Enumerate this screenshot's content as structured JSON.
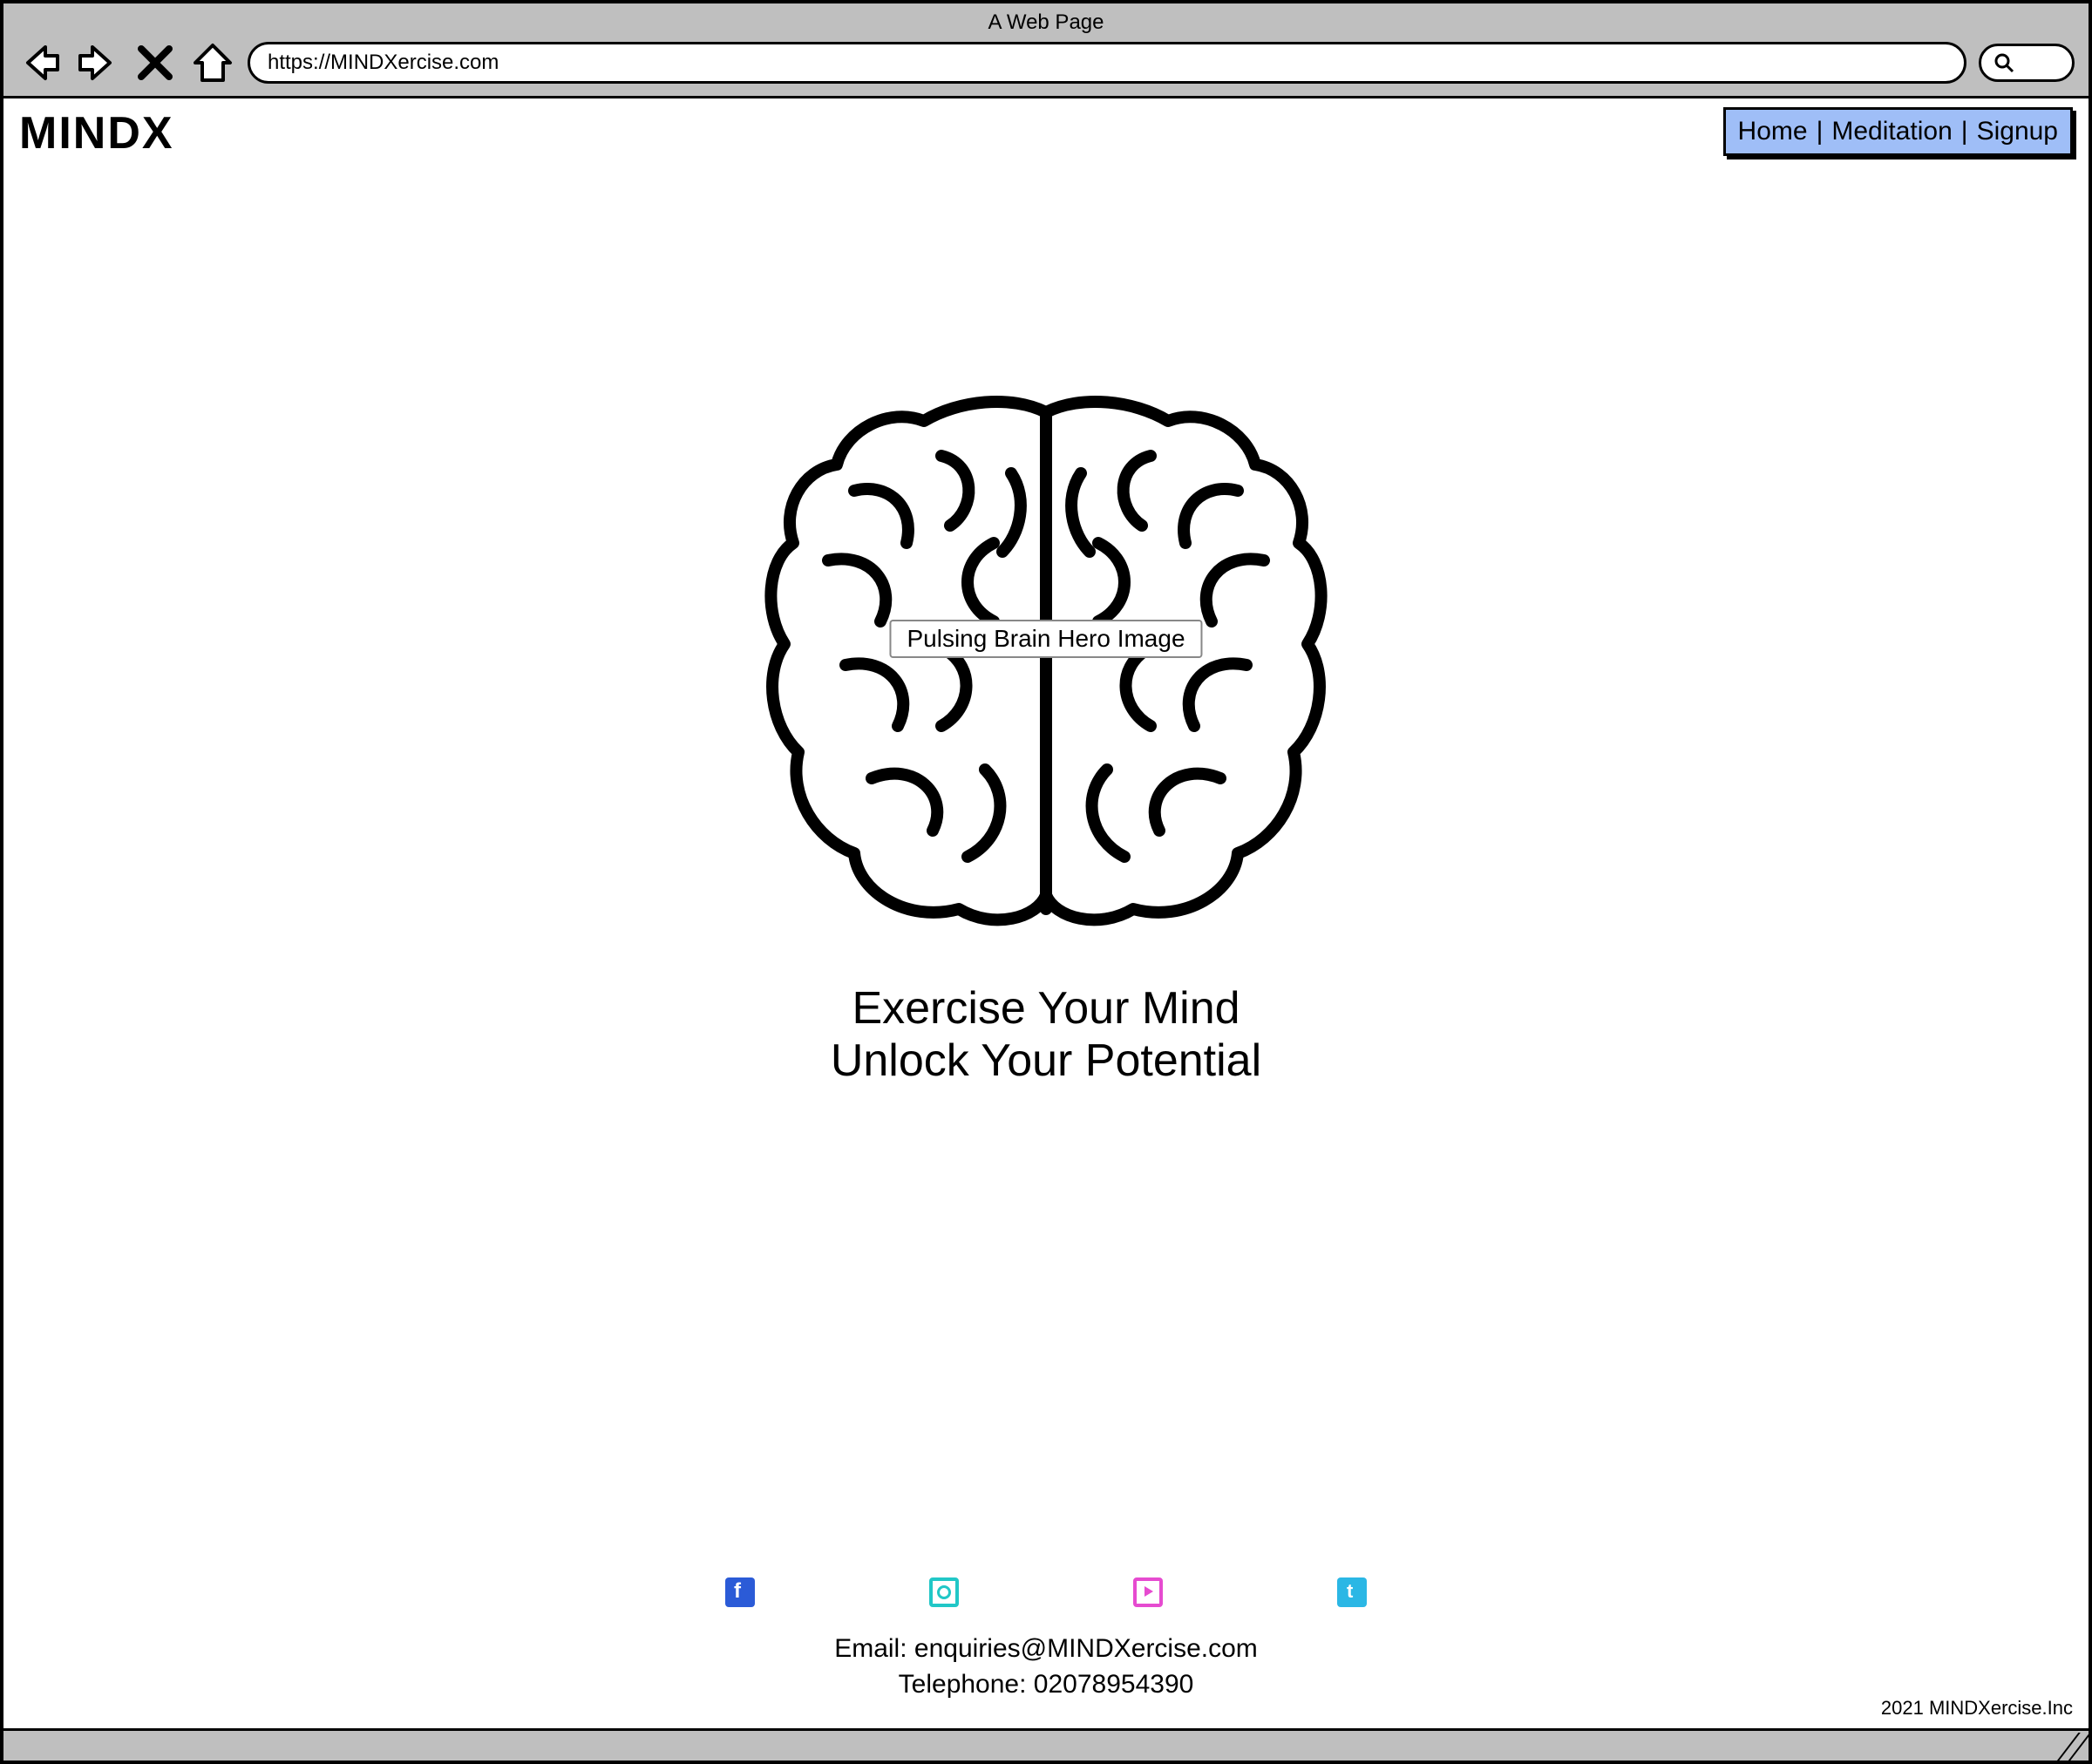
{
  "browser": {
    "title": "A Web Page",
    "url": "https://MINDXercise.com"
  },
  "header": {
    "logo": "MINDX",
    "nav": {
      "home": "Home",
      "meditation": "Meditation",
      "signup": "Signup"
    }
  },
  "hero": {
    "image_label": "Pulsing Brain Hero Image",
    "tagline_line1": "Exercise Your Mind",
    "tagline_line2": "Unlock Your Potential"
  },
  "footer": {
    "email_label": "Email: ",
    "email_value": "enquiries@MINDXercise.com",
    "phone_label": "Telephone: ",
    "phone_value": "02078954390",
    "copyright": "2021 MINDXercise.Inc"
  }
}
